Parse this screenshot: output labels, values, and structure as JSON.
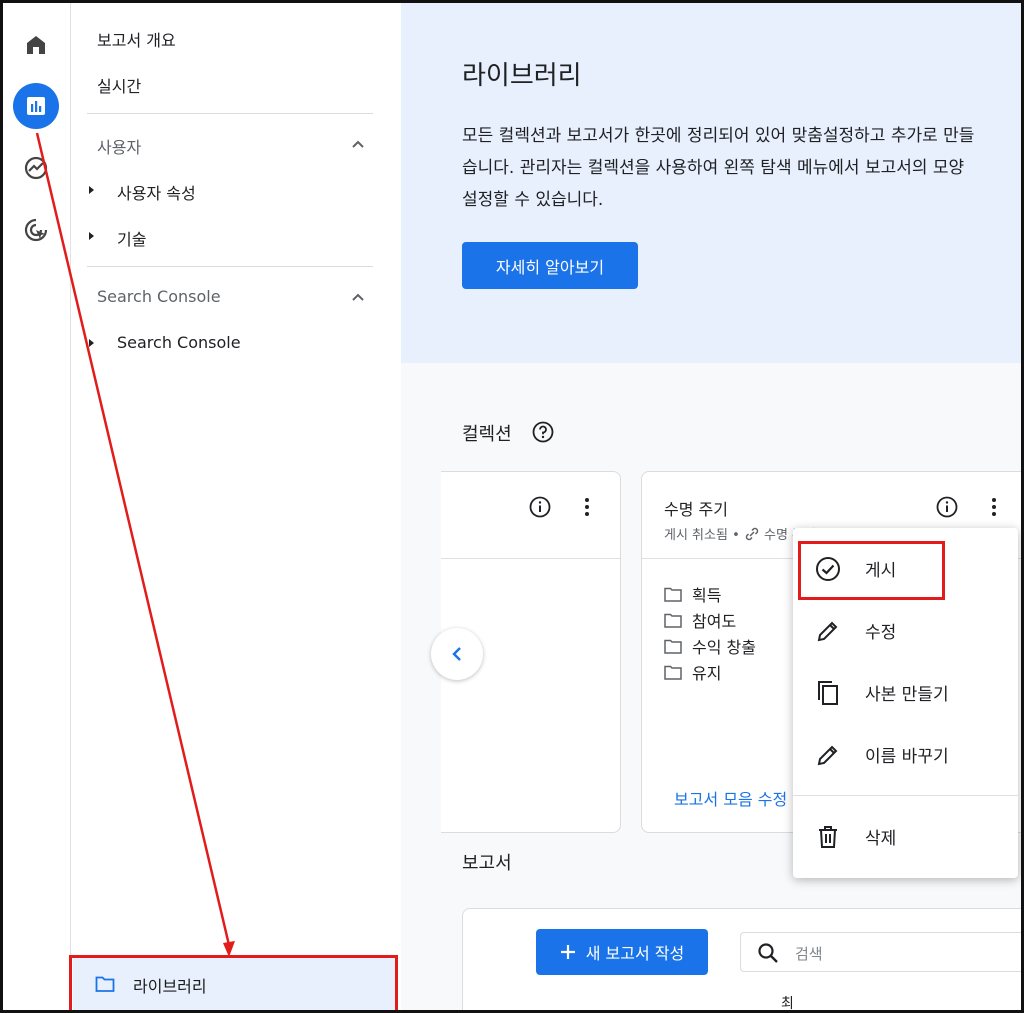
{
  "rail": {
    "items": [
      {
        "name": "home-icon",
        "active": false
      },
      {
        "name": "reports-icon",
        "active": true
      },
      {
        "name": "explore-icon",
        "active": false
      },
      {
        "name": "advertising-icon",
        "active": false
      }
    ]
  },
  "sidebar": {
    "overview": "보고서 개요",
    "realtime": "실시간",
    "section_user": "사용자",
    "user_attributes": "사용자 속성",
    "tech": "기술",
    "section_search_console": "Search Console",
    "search_console": "Search Console",
    "library": "라이브러리"
  },
  "hero": {
    "title": "라이브러리",
    "line1": "모든 컬렉션과 보고서가 한곳에 정리되어 있어 맞춤설정하고 추가로 만들",
    "line2": "습니다. 관리자는 컬렉션을 사용하여 왼쪽 탐색 메뉴에서 보고서의 모양",
    "line3": "설정할 수 있습니다.",
    "button": "자세히 알아보기"
  },
  "collections": {
    "title": "컬렉션",
    "card": {
      "title": "수명 주기",
      "status": "게시 취소됨",
      "sub_extra": "수명 주기",
      "folders": [
        "획득",
        "참여도",
        "수익 창출",
        "유지"
      ],
      "edit_link": "보고서 모음 수정"
    }
  },
  "menu": {
    "items": [
      {
        "label": "게시",
        "icon": "check-circle-icon"
      },
      {
        "label": "수정",
        "icon": "pencil-icon"
      },
      {
        "label": "사본 만들기",
        "icon": "copy-icon"
      },
      {
        "label": "이름 바꾸기",
        "icon": "pencil-icon"
      },
      {
        "label": "삭제",
        "icon": "trash-icon"
      }
    ]
  },
  "reports": {
    "title": "보고서",
    "new_button": "새 보고서 작성",
    "search_placeholder": "검색",
    "column_head": "최"
  },
  "colors": {
    "accent": "#1a73e8",
    "annotation": "#e21b1b",
    "hero_bg": "#e8f0fe"
  }
}
